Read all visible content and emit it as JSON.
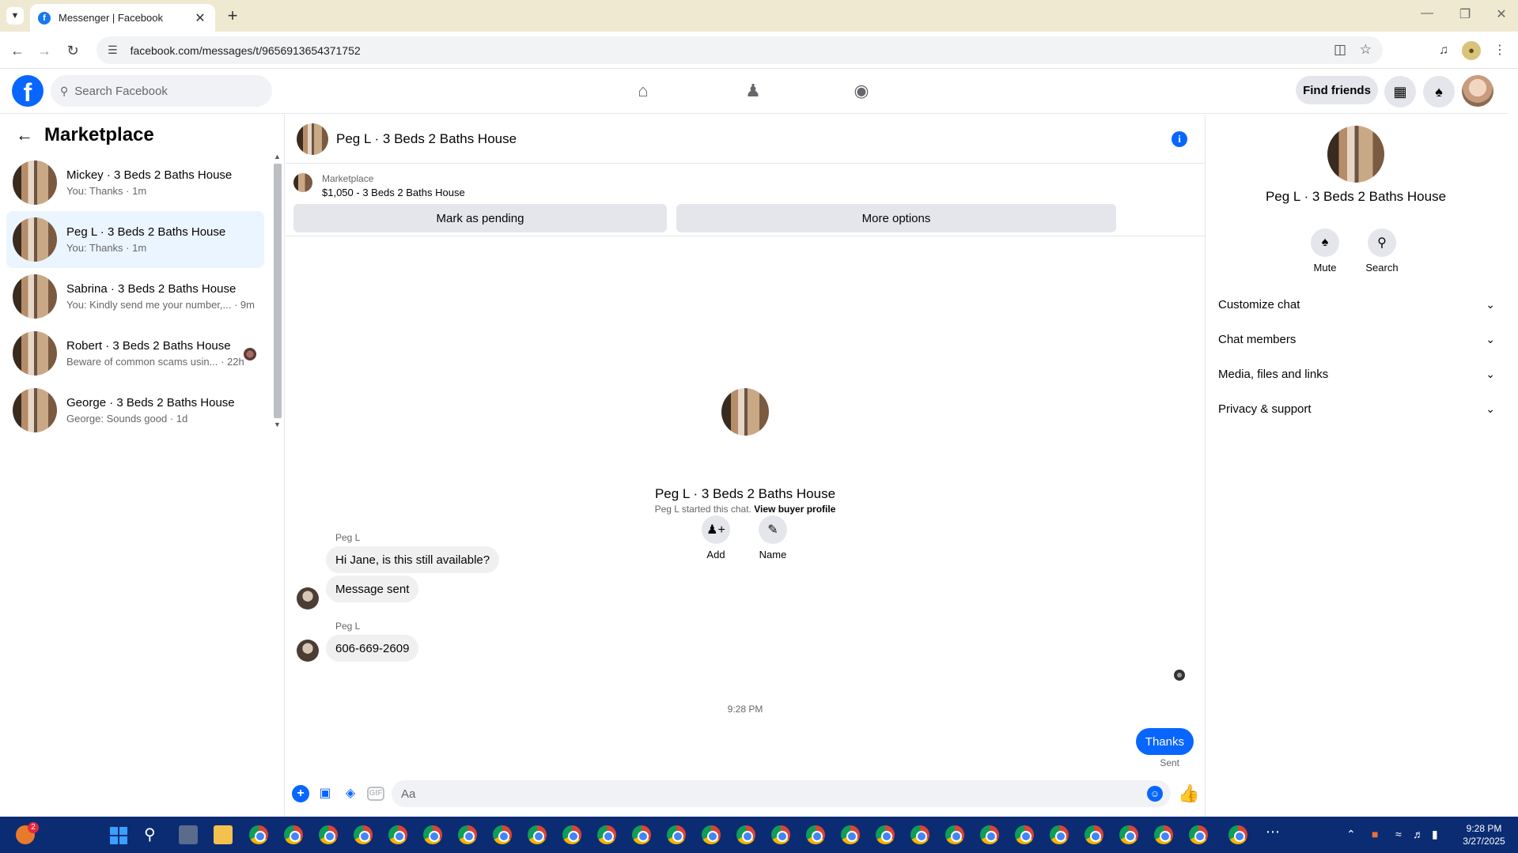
{
  "browser": {
    "tab_title": "Messenger | Facebook",
    "url": "facebook.com/messages/t/9656913654371752"
  },
  "header": {
    "search_placeholder": "Search Facebook",
    "find_friends_label": "Find friends"
  },
  "sidebar": {
    "title": "Marketplace",
    "conversations": [
      {
        "name": "Mickey · 3 Beds 2 Baths House",
        "preview": "You: Thanks · 1m"
      },
      {
        "name": "Peg L · 3 Beds 2 Baths House",
        "preview": "You: Thanks · 1m"
      },
      {
        "name": "Sabrina · 3 Beds 2 Baths House",
        "preview": "You: Kindly send me your number,... · 9m"
      },
      {
        "name": "Robert · 3 Beds 2 Baths House",
        "preview": "Beware of common scams usin... · 22h"
      },
      {
        "name": "George · 3 Beds 2 Baths House",
        "preview": "George: Sounds good · 1d"
      }
    ]
  },
  "chat": {
    "title": "Peg L · 3 Beds 2 Baths House",
    "marketplace_label": "Marketplace",
    "listing": "$1,050 - 3 Beds 2 Baths House",
    "mark_pending_label": "Mark as pending",
    "more_options_label": "More options",
    "hero_name": "Peg L · 3 Beds 2 Baths House",
    "add_label": "Add",
    "name_label": "Name",
    "started_text": "Peg L started this chat.",
    "view_profile_label": "View buyer profile",
    "messages": [
      {
        "sender": "Peg L",
        "text": "Hi Jane, is this still available?"
      },
      {
        "sender": "",
        "text": "Message sent"
      },
      {
        "sender": "Peg L",
        "text": "606-669-2609"
      }
    ],
    "timestamp": "9:28 PM",
    "outgoing": "Thanks",
    "sent_label": "Sent",
    "composer_placeholder": "Aa"
  },
  "info_panel": {
    "name": "Peg L · 3 Beds 2 Baths House",
    "mute_label": "Mute",
    "search_label": "Search",
    "sections": [
      "Customize chat",
      "Chat members",
      "Media, files and links",
      "Privacy & support"
    ]
  },
  "taskbar": {
    "notification_count": "2",
    "time": "9:28 PM",
    "date": "3/27/2025"
  },
  "colors": {
    "facebook_blue": "#0866ff",
    "active_row": "#ebf5ff",
    "taskbar": "#0b2c73",
    "tabbar": "#efe9d1"
  }
}
